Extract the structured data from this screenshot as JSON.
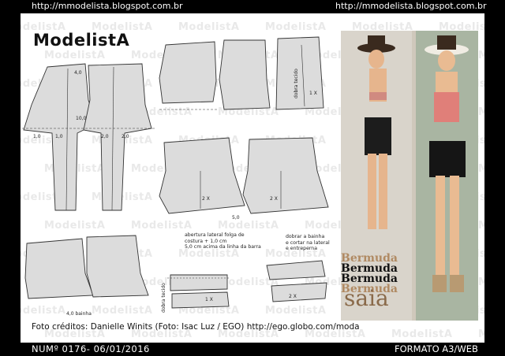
{
  "header": {
    "url_left": "http://mmodelista.blogspot.com.br",
    "url_right": "http://mmodelista.blogspot.com.br"
  },
  "watermark": "ModelistA",
  "logo": "ModelistA",
  "labels": {
    "m40": "4,0",
    "m100": "10,0",
    "m10a": "1,0",
    "m10b": "1,0",
    "m20a": "2,0",
    "m20b": "2,0",
    "hem": "4,0 bainha",
    "fold1": "dobra tecido",
    "fold2": "dobra tecido",
    "one_x": "1 X",
    "two_x_a": "2 X",
    "two_x_b": "2 X",
    "one_x_b": "1 X",
    "two_x_c": "2 X",
    "five": "5,0"
  },
  "notes": {
    "side_opening": [
      "abertura lateral folga de",
      "costura + 1,0 cm",
      "5,0 cm acima da linha da barra"
    ],
    "fold_hem": [
      "dobrar a bainha",
      "e cortar na lateral",
      "e entreperna"
    ]
  },
  "garment_words": [
    "Bermuda",
    "Bermuda",
    "Bermuda",
    "Bermuda"
  ],
  "garment_word_colors": [
    "#b08a63",
    "#111111",
    "#111111",
    "#b08a63"
  ],
  "saia": "saia",
  "credits": "Foto créditos:  Danielle Winits (Foto: Isac Luz / EGO) http://ego.globo.com/moda",
  "footer": {
    "number": "NUMº 0176- 06/01/2016",
    "format": "FORMATO A3/WEB"
  }
}
